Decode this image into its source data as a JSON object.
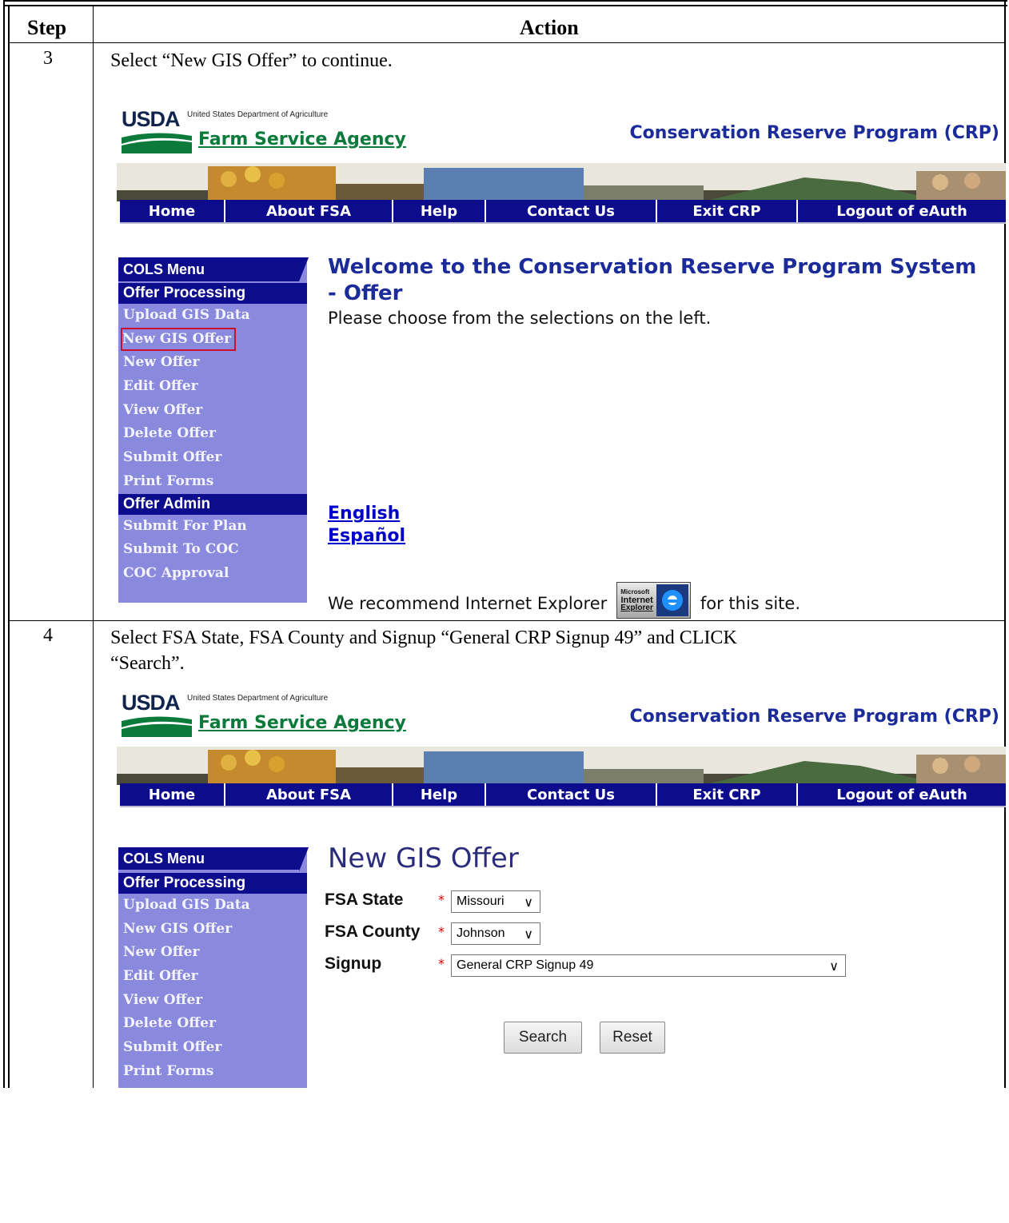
{
  "table": {
    "col_step": "Step",
    "col_action": "Action"
  },
  "steps": [
    {
      "number": "3",
      "instruction": "Select “New GIS Offer” to continue."
    },
    {
      "number": "4",
      "instruction_line1": "Select FSA State, FSA County and Signup “General CRP Signup 49” and CLICK",
      "instruction_line2": "“Search”."
    }
  ],
  "header": {
    "logo_text": "USDA",
    "department": "United States Department of Agriculture",
    "agency": "Farm Service Agency",
    "program_title": "Conservation Reserve Program (CRP)"
  },
  "nav": [
    "Home",
    "About FSA",
    "Help",
    "Contact Us",
    "Exit CRP",
    "Logout of eAuth"
  ],
  "menu": {
    "title": "COLS Menu",
    "section1": "Offer Processing",
    "items1": [
      "Upload GIS Data",
      "New GIS Offer",
      "New Offer",
      "Edit Offer",
      "View Offer",
      "Delete Offer",
      "Submit Offer",
      "Print Forms"
    ],
    "section2": "Offer Admin",
    "items2": [
      "Submit For Plan",
      "Submit To COC",
      "COC Approval"
    ]
  },
  "welcome": {
    "title_line1": "Welcome to the Conservation Reserve Program System",
    "title_line2": "- Offer",
    "subtitle": "Please choose from the selections on the left.",
    "lang_english": "English",
    "lang_spanish": "Español",
    "recommend_before": "We recommend Internet Explorer",
    "recommend_after": "for this site.",
    "ie_badge_line1": "Microsoft",
    "ie_badge_line2": "Internet",
    "ie_badge_line3": "Explorer"
  },
  "form": {
    "title": "New GIS Offer",
    "state_label": "FSA State",
    "state_value": "Missouri",
    "county_label": "FSA County",
    "county_value": "Johnson",
    "signup_label": "Signup",
    "signup_value": "General CRP Signup 49",
    "required_mark": "*",
    "search_button": "Search",
    "reset_button": "Reset"
  },
  "colors": {
    "nav_bg": "#0c0c8c",
    "menu_bg": "#8989dd",
    "title_blue": "#1b2b9a",
    "agency_green": "#0b7a3b",
    "highlight_red": "#c8102e"
  }
}
